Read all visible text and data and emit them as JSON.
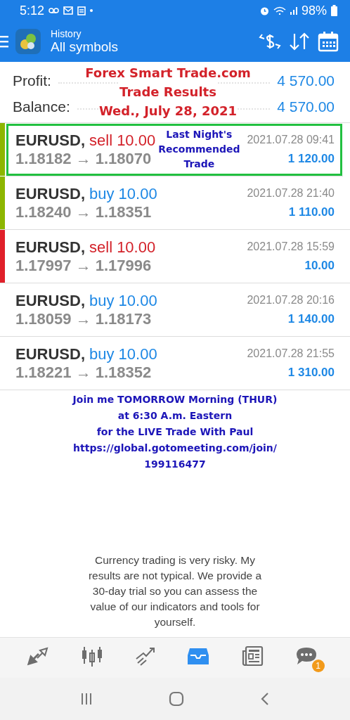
{
  "status_bar": {
    "time": "5:12",
    "battery": "98%"
  },
  "app_bar": {
    "subtitle": "History",
    "title": "All symbols"
  },
  "summary": [
    {
      "label": "Profit:",
      "value": "4 570.00"
    },
    {
      "label": "Balance:",
      "value": "4 570.00"
    }
  ],
  "banner": [
    "Forex Smart Trade.com",
    "Trade Results",
    "Wed., July 28, 2021"
  ],
  "trades": [
    {
      "symbol": "EURUSD,",
      "kind": "sell",
      "volume": "sell 10.00",
      "prices": "1.18182 → 1.18070",
      "time": "2021.07.28 09:41",
      "profit": "1 120.00",
      "color": "#8db600",
      "highlighted": true
    },
    {
      "symbol": "EURUSD,",
      "kind": "buy",
      "volume": "buy 10.00",
      "prices": "1.18240 → 1.18351",
      "time": "2021.07.28 21:40",
      "profit": "1 110.00",
      "color": "#8db600",
      "highlighted": false
    },
    {
      "symbol": "EURUSD,",
      "kind": "sell",
      "volume": "sell 10.00",
      "prices": "1.17997 → 1.17996",
      "time": "2021.07.28 15:59",
      "profit": "10.00",
      "color": "#e0202a",
      "highlighted": false
    },
    {
      "symbol": "EURUSD,",
      "kind": "buy",
      "volume": "buy 10.00",
      "prices": "1.18059 → 1.18173",
      "time": "2021.07.28 20:16",
      "profit": "1 140.00",
      "highlighted": false
    },
    {
      "symbol": "EURUSD,",
      "kind": "buy",
      "volume": "buy 10.00",
      "prices": "1.18221 → 1.18352",
      "time": "2021.07.28 21:55",
      "profit": "1 310.00",
      "highlighted": false
    }
  ],
  "trade_note": [
    "Last Night's",
    "Recommended",
    "Trade"
  ],
  "promo": [
    "Join me TOMORROW Morning (THUR)",
    "at 6:30 A.m. Eastern",
    "for the LIVE Trade With Paul",
    "https://global.gotomeeting.com/join/",
    "199116477"
  ],
  "disclaimer": "Currency trading is very risky. My results are not typical. We provide a 30-day trial so you can assess the value of our indicators and tools for yourself.",
  "bottom_nav": [
    {
      "kind": "trade",
      "selected": false
    },
    {
      "kind": "chart",
      "selected": false
    },
    {
      "kind": "trends",
      "selected": false
    },
    {
      "kind": "history",
      "selected": true
    },
    {
      "kind": "news",
      "selected": false
    },
    {
      "kind": "chat",
      "selected": false,
      "badge": "1"
    }
  ]
}
